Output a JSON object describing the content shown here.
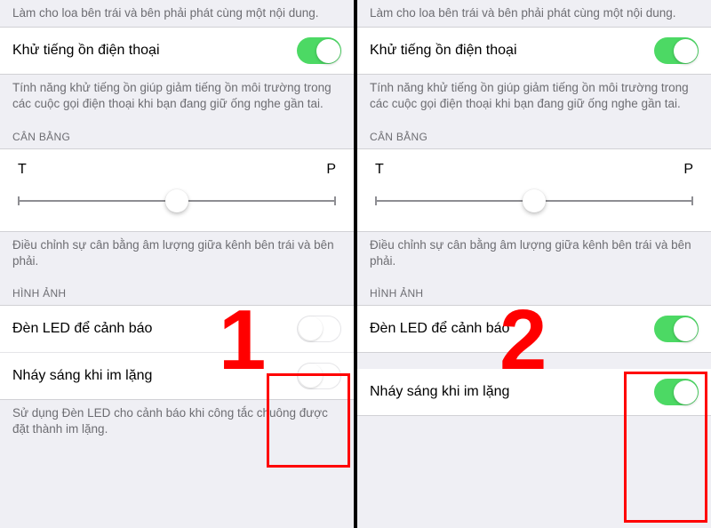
{
  "left": {
    "mono_footer": "Làm cho loa bên trái và bên phải phát cùng một nội dung.",
    "noise": {
      "label": "Khử tiếng ồn điện thoại",
      "on": true
    },
    "noise_footer": "Tính năng khử tiếng ồn giúp giảm tiếng ồn môi trường trong các cuộc gọi điện thoại khi bạn đang giữ ống nghe gần tai.",
    "balance_header": "CÂN BẰNG",
    "balance_left": "T",
    "balance_right": "P",
    "balance_footer": "Điều chỉnh sự cân bằng âm lượng giữa kênh bên trái và bên phải.",
    "image_header": "HÌNH ẢNH",
    "led": {
      "label": "Đèn LED để cảnh báo",
      "on": false
    },
    "flash": {
      "label": "Nháy sáng khi im lặng",
      "on": false
    },
    "led_footer": "Sử dụng Đèn LED cho cảnh báo khi công tắc chuông được đặt thành im lặng.",
    "annotation": "1"
  },
  "right": {
    "mono_footer": "Làm cho loa bên trái và bên phải phát cùng một nội dung.",
    "noise": {
      "label": "Khử tiếng ồn điện thoại",
      "on": true
    },
    "noise_footer": "Tính năng khử tiếng ồn giúp giảm tiếng ồn môi trường trong các cuộc gọi điện thoại khi bạn đang giữ ống nghe gần tai.",
    "balance_header": "CÂN BẰNG",
    "balance_left": "T",
    "balance_right": "P",
    "balance_footer": "Điều chỉnh sự cân bằng âm lượng giữa kênh bên trái và bên phải.",
    "image_header": "HÌNH ẢNH",
    "led": {
      "label": "Đèn LED để cảnh báo",
      "on": true
    },
    "flash": {
      "label": "Nháy sáng khi im lặng",
      "on": true
    },
    "annotation": "2"
  }
}
